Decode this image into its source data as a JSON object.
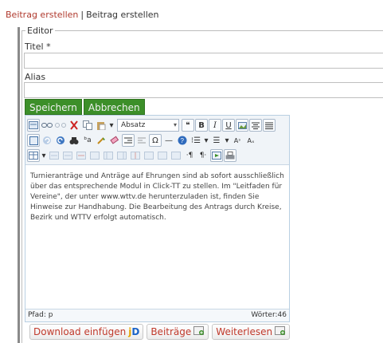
{
  "breadcrumb": {
    "link": "Beitrag erstellen",
    "separator": "|",
    "current": "Beitrag erstellen"
  },
  "editor_section": {
    "legend": "Editor"
  },
  "fields": {
    "title_label": "Titel *",
    "title_value": "",
    "alias_label": "Alias",
    "alias_value": ""
  },
  "actions": {
    "save": "Speichern",
    "cancel": "Abbrechen"
  },
  "toolbar": {
    "format_select": "Absatz"
  },
  "content": {
    "text": "Turnieranträge und Anträge auf Ehrungen sind ab sofort ausschließlich über das entsprechende Modul in Click-TT zu stellen. Im \"Leitfaden für Vereine\", der unter www.wttv.de herunterzuladen ist, finden Sie Hinweise zur Handhabung. Die Bearbeitung des Antrags durch Kreise, Bezirk und WTTV erfolgt automatisch."
  },
  "statusbar": {
    "path": "Pfad: p",
    "word_count": "Wörter:46"
  },
  "buttons": {
    "download": "Download einfügen",
    "download_logo_j": "j",
    "download_logo_d": "D",
    "articles": "Beiträge",
    "readmore": "Weiterlesen"
  },
  "colors": {
    "green": "#3c8f29",
    "link_red": "#b03a2e"
  }
}
